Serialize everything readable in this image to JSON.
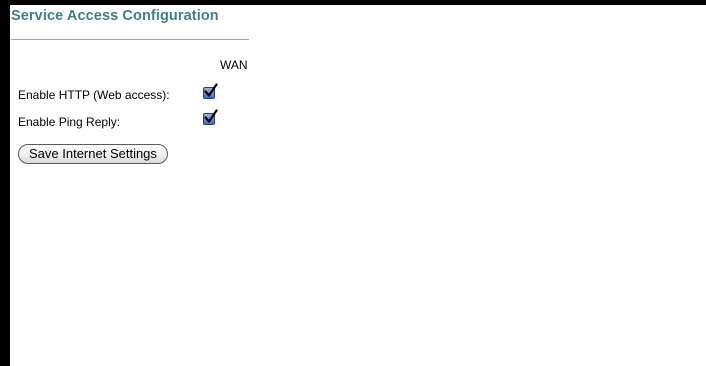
{
  "section": {
    "title": "Service Access Configuration",
    "column_header": "WAN"
  },
  "rows": [
    {
      "label": "Enable HTTP (Web access):",
      "checked": true
    },
    {
      "label": "Enable Ping Reply:",
      "checked": true
    }
  ],
  "save_button": {
    "label": "Save Internet Settings"
  },
  "colors": {
    "title": "#3f7f86",
    "checkbox_fill": "#3d6fc7",
    "checkmark": "#000000"
  },
  "icons": [
    "checkmark-icon"
  ]
}
